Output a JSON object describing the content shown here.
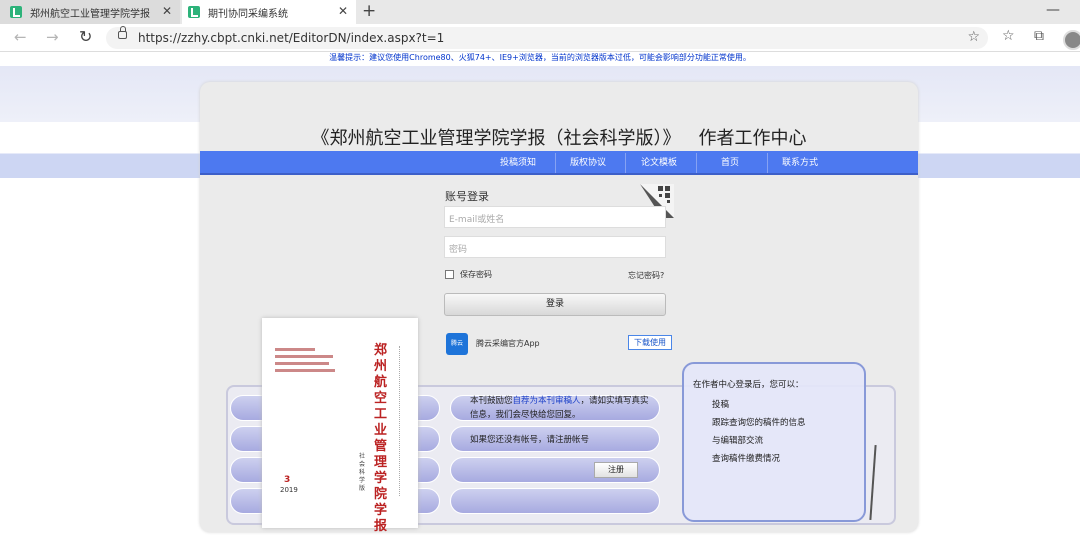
{
  "browser": {
    "tabs": [
      {
        "label": "郑州航空工业管理学院学报（社会"
      },
      {
        "label": "期刊协同采编系统"
      }
    ],
    "url": "https://zzhy.cbpt.cnki.net/EditorDN/index.aspx?t=1"
  },
  "page": {
    "notice": "温馨提示：建议您使用Chrome80、火狐74+、IE9+浏览器，当前的浏览器版本过低，可能会影响部分功能正常使用。",
    "title_journal": "《郑州航空工业管理学院学报（社会科学版）》",
    "title_center": "作者工作中心",
    "menu": [
      "投稿须知",
      "版权协议",
      "论文模板",
      "首页",
      "联系方式"
    ]
  },
  "login": {
    "heading": "账号登录",
    "username_placeholder": "E-mail或姓名",
    "password_placeholder": "密码",
    "remember_label": "保存密码",
    "forgot_label": "忘记密码?",
    "submit_label": "登录",
    "app_name": "腾云采编官方App",
    "app_icon_text": "腾云",
    "download_label": "下载使用"
  },
  "cover": {
    "title": "郑州航空工业管理学院学报",
    "subtitle": "社会科学版",
    "issue": "3",
    "year": "2019"
  },
  "register": {
    "info_pre": "本刊鼓励您",
    "info_highlight": "自荐为本刊审稿人",
    "info_post": "，请如实填写真实信息，我们会尽快给您回复。",
    "no_account": "如果您还没有帐号，请注册帐号",
    "button": "注册"
  },
  "benefits": {
    "heading": "在作者中心登录后，您可以：",
    "items": [
      "投稿",
      "跟踪查询您的稿件的信息",
      "与编辑部交流",
      "查询稿件缴费情况"
    ]
  },
  "colors": {
    "menu_bar": "#4d79f0",
    "notice_text": "#0033cc",
    "favicon": "#2db37a"
  }
}
